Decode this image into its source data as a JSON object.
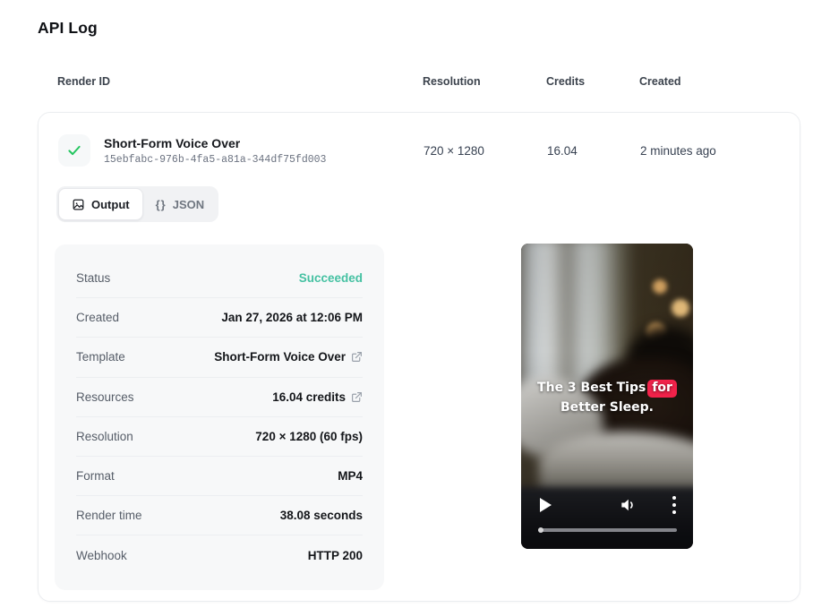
{
  "page": {
    "title": "API Log"
  },
  "table": {
    "headers": {
      "render_id": "Render ID",
      "resolution": "Resolution",
      "credits": "Credits",
      "created": "Created"
    },
    "row": {
      "status_icon": "check-icon",
      "title": "Short-Form Voice Over",
      "render_id": "15ebfabc-976b-4fa5-a81a-344df75fd003",
      "resolution": "720 × 1280",
      "credits": "16.04",
      "created": "2 minutes ago"
    }
  },
  "tabs": [
    {
      "label": "Output",
      "icon": "image-icon",
      "active": true
    },
    {
      "label": "JSON",
      "icon": "braces-icon",
      "active": false
    }
  ],
  "details": {
    "rows": [
      {
        "label": "Status",
        "value": "Succeeded"
      },
      {
        "label": "Created",
        "value": "Jan 27, 2026 at 12:06 PM"
      },
      {
        "label": "Template",
        "value": "Short-Form Voice Over"
      },
      {
        "label": "Resources",
        "value": "16.04 credits"
      },
      {
        "label": "Resolution",
        "value": "720 × 1280 (60 fps)"
      },
      {
        "label": "Format",
        "value": "MP4"
      },
      {
        "label": "Render time",
        "value": "38.08 seconds"
      },
      {
        "label": "Webhook",
        "value": "HTTP 200"
      }
    ]
  },
  "video": {
    "caption_line1_text": "The 3 Best Tips",
    "caption_highlight": "for",
    "caption_line2": "Better Sleep.",
    "highlight_color": "#f1224a",
    "controls": [
      "play-icon",
      "volume-icon",
      "more-icon"
    ]
  },
  "colors": {
    "status_success": "#45c1a2",
    "check_green": "#22c55e",
    "panel_bg": "#f7f8f9",
    "card_border": "#ebedf0"
  }
}
